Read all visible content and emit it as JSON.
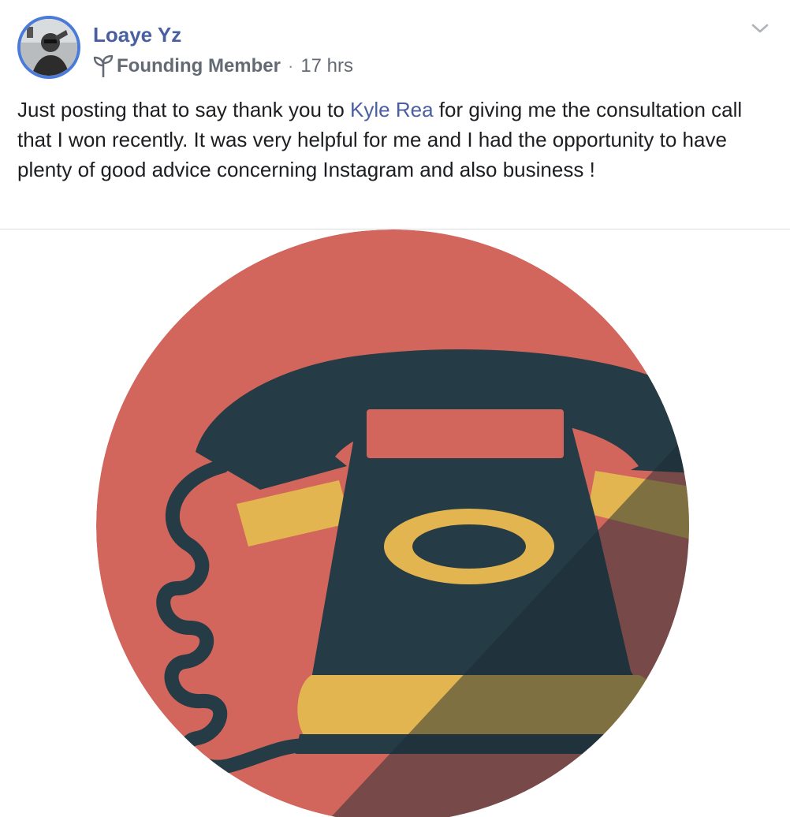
{
  "post": {
    "author": {
      "name": "Loaye Yz",
      "badge": "Founding Member",
      "badge_icon": "sprout-icon"
    },
    "separator": "·",
    "timestamp": "17 hrs",
    "menu_icon": "chevron-down-icon",
    "text_before_mention": "Just posting that to say thank you to ",
    "mention": "Kyle Rea",
    "text_after_mention": " for giving me the consultation call that I won recently. It was very helpful for me and I had the opportunity to have plenty of good advice concerning Instagram and also business !",
    "image": {
      "subject": "telephone-icon",
      "colors": {
        "background_circle": "#d2665c",
        "phone_body": "#253b45",
        "accent": "#e3b550",
        "accent_shaded": "#a7843e"
      }
    }
  },
  "colors": {
    "link": "#4a5fa0",
    "text": "#1c1e21",
    "meta": "#646a73",
    "avatar_ring": "#4b7bd8"
  }
}
